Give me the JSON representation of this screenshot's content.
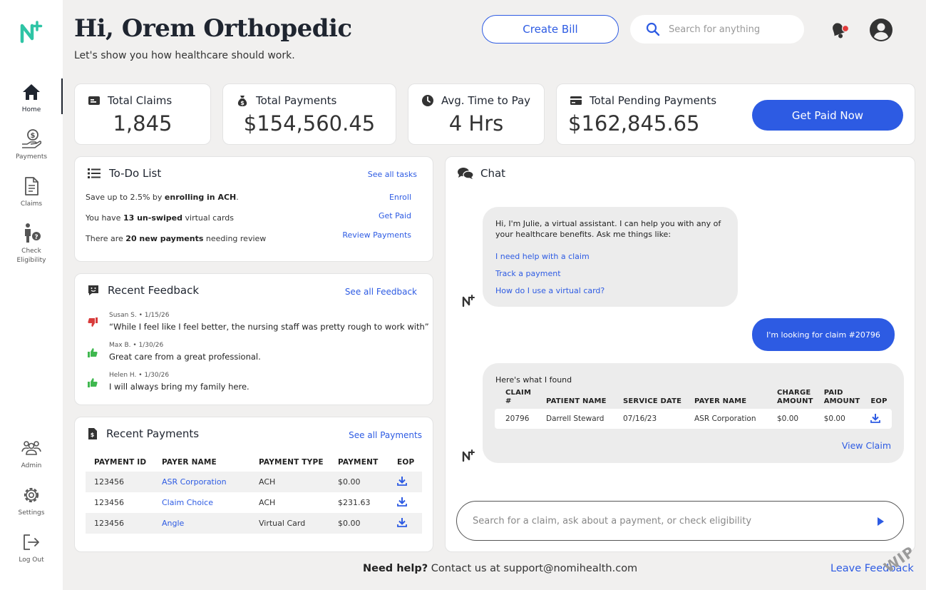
{
  "app": {
    "brand_color": "#2d5be3",
    "accent_green": "#2ec4a5"
  },
  "sidebar": {
    "items": [
      {
        "label": "Home",
        "icon": "home-icon",
        "active": true
      },
      {
        "label": "Payments",
        "icon": "payments-icon"
      },
      {
        "label": "Claims",
        "icon": "claims-icon"
      },
      {
        "label": "Check",
        "label2": "Eligibility",
        "icon": "check-eligibility-icon"
      },
      {
        "label": "Admin",
        "icon": "admin-icon"
      },
      {
        "label": "Settings",
        "icon": "gear-icon"
      },
      {
        "label": "Log Out",
        "icon": "logout-icon"
      }
    ]
  },
  "header": {
    "title": "Hi, Orem Orthopedic",
    "subtitle": "Let's show you how healthcare should work.",
    "create_bill": "Create Bill",
    "search_placeholder": "Search for anything"
  },
  "stats": {
    "total_claims": {
      "label": "Total Claims",
      "value": "1,845"
    },
    "total_payments": {
      "label": "Total Payments",
      "value": "$154,560.45"
    },
    "avg_time": {
      "label": "Avg. Time to Pay",
      "value": "4 Hrs"
    },
    "pending": {
      "label": "Total Pending Payments",
      "value": "$162,845.65",
      "button": "Get Paid Now"
    }
  },
  "todo": {
    "title": "To-Do List",
    "see_all": "See all tasks",
    "items": [
      {
        "pre": "Save up to 2.5% by ",
        "bold": "enrolling in ACH",
        "post": ".",
        "action": "Enroll"
      },
      {
        "pre": "You have ",
        "bold": "13 un-swiped",
        "post": " virtual cards",
        "action": "Get Paid"
      },
      {
        "pre": "There are ",
        "bold": "20 new payments",
        "post": " needing review",
        "action": "Review Payments"
      }
    ]
  },
  "feedback": {
    "title": "Recent Feedback",
    "see_all": "See all Feedback",
    "items": [
      {
        "meta": "Susan S. • 1/15/26",
        "text": "“While I feel like I feel better, the nursing staff was pretty rough to work with”",
        "sentiment": "negative"
      },
      {
        "meta": "Max B. • 1/30/26",
        "text": "Great care from a great professional.",
        "sentiment": "positive"
      },
      {
        "meta": "Helen H. • 1/30/26",
        "text": "I will always bring my family here.",
        "sentiment": "positive"
      }
    ]
  },
  "payments": {
    "title": "Recent Payments",
    "see_all": "See all Payments",
    "columns": [
      "PAYMENT ID",
      "PAYER NAME",
      "PAYMENT TYPE",
      "PAYMENT",
      "EOP"
    ],
    "rows": [
      {
        "id": "123456",
        "payer": "ASR Corporation",
        "type": "ACH",
        "amount": "$0.00"
      },
      {
        "id": "123456",
        "payer": "Claim Choice",
        "type": "ACH",
        "amount": "$231.63"
      },
      {
        "id": "123456",
        "payer": "Angle",
        "type": "Virtual Card",
        "amount": "$0.00"
      }
    ]
  },
  "chat": {
    "title": "Chat",
    "intro": "Hi, I'm Julie, a virtual assistant. I can help you with any of your healthcare benefits. Ask me things like:",
    "suggestions": [
      "I need help with a claim",
      "Track a payment",
      "How do I use a virtual card?"
    ],
    "user_message": "I'm looking for claim #20796",
    "result_intro": "Here's what I found",
    "claim_columns": [
      "CLAIM #",
      "PATIENT NAME",
      "SERVICE DATE",
      "PAYER NAME",
      "CHARGE AMOUNT",
      "PAID AMOUNT",
      "EOP"
    ],
    "claim_row": {
      "claim": "20796",
      "patient": "Darrell Steward",
      "date": "07/16/23",
      "payer": "ASR Corporation",
      "charge": "$0.00",
      "paid": "$0.00"
    },
    "view_claim": "View Claim",
    "input_placeholder": "Search for a claim, ask about a payment, or check eligibility"
  },
  "footer": {
    "need_help": "Need help?",
    "contact": " Contact us at support@nomihealth.com",
    "leave_feedback": "Leave Feedback",
    "badge": "WIP"
  }
}
